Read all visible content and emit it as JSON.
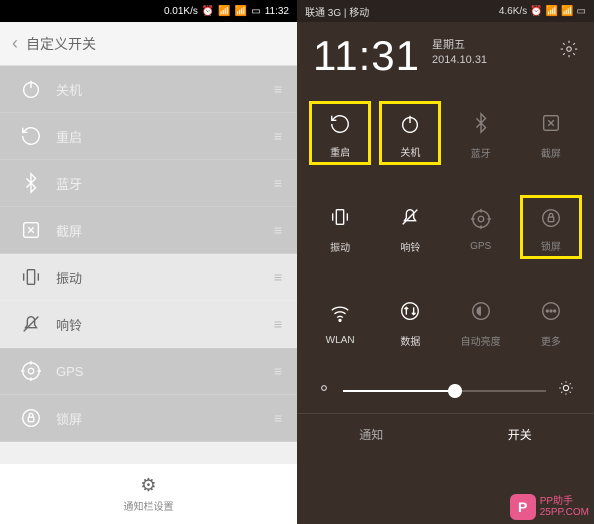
{
  "left": {
    "status": {
      "speed": "0.01K/s",
      "time": "11:32"
    },
    "header": {
      "title": "自定义开关"
    },
    "items": [
      {
        "icon": "power",
        "label": "关机"
      },
      {
        "icon": "restart",
        "label": "重启"
      },
      {
        "icon": "bluetooth",
        "label": "蓝牙"
      },
      {
        "icon": "screenshot",
        "label": "截屏"
      },
      {
        "icon": "vibrate",
        "label": "振动",
        "active": true
      },
      {
        "icon": "mute",
        "label": "响铃",
        "active": true
      },
      {
        "icon": "gps",
        "label": "GPS"
      },
      {
        "icon": "lock",
        "label": "锁屏"
      }
    ],
    "footer": {
      "label": "通知栏设置"
    }
  },
  "right": {
    "status": {
      "carrier": "联通 3G | 移动",
      "speed": "4.6K/s"
    },
    "clock": {
      "time": "11:31",
      "weekday": "星期五",
      "date": "2014.10.31"
    },
    "tiles_row1": [
      {
        "icon": "restart",
        "label": "重启",
        "hl": true
      },
      {
        "icon": "power",
        "label": "关机",
        "hl": true
      },
      {
        "icon": "bluetooth",
        "label": "蓝牙",
        "dim": true
      },
      {
        "icon": "screenshot",
        "label": "截屏",
        "dim": true
      }
    ],
    "tiles_row2": [
      {
        "icon": "vibrate",
        "label": "振动"
      },
      {
        "icon": "mute",
        "label": "响铃"
      },
      {
        "icon": "gps",
        "label": "GPS",
        "dim": true
      },
      {
        "icon": "lock",
        "label": "锁屏",
        "dim": true,
        "hl": true
      }
    ],
    "tiles_row3": [
      {
        "icon": "wifi",
        "label": "WLAN"
      },
      {
        "icon": "data",
        "label": "数据"
      },
      {
        "icon": "brightness",
        "label": "自动亮度",
        "dim": true
      },
      {
        "icon": "more",
        "label": "更多",
        "dim": true
      }
    ],
    "slider": {
      "value": 55
    },
    "tabs": {
      "left": "通知",
      "right": "开关",
      "active": "right"
    }
  },
  "watermark": {
    "brand": "PP助手",
    "url": "25PP.COM"
  }
}
